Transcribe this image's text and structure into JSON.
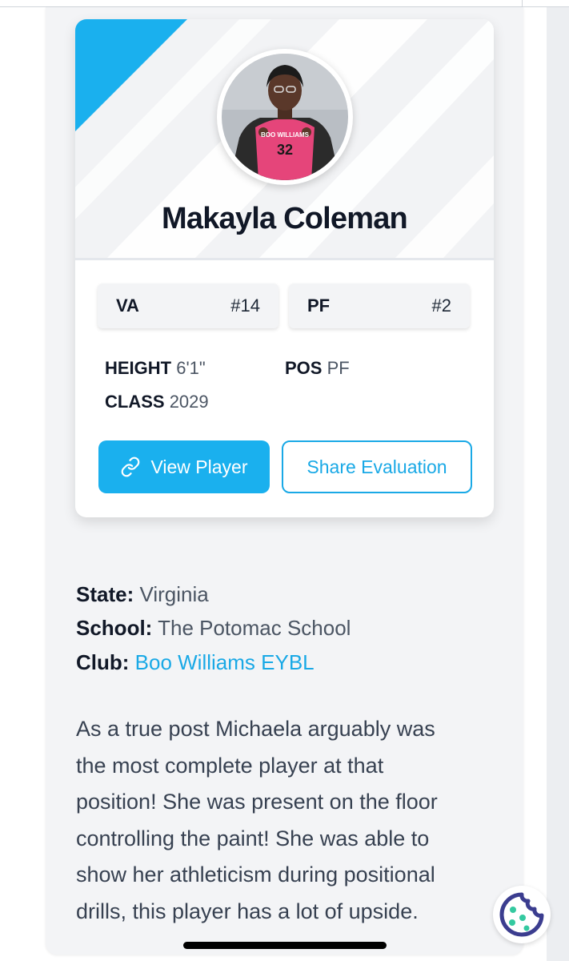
{
  "player": {
    "name": "Makayla Coleman",
    "jersey_text": "BOO WILLIAMS",
    "jersey_number": "32"
  },
  "rankings": [
    {
      "code": "VA",
      "rank": "#14"
    },
    {
      "code": "PF",
      "rank": "#2"
    }
  ],
  "attributes": {
    "height_label": "HEIGHT",
    "height_value": "6'1\"",
    "class_label": "CLASS",
    "class_value": "2029",
    "pos_label": "POS",
    "pos_value": "PF"
  },
  "actions": {
    "view_player": "View Player",
    "share_evaluation": "Share Evaluation"
  },
  "details": {
    "state_label": "State:",
    "state_value": "Virginia",
    "school_label": "School:",
    "school_value": "The Potomac School",
    "club_label": "Club:",
    "club_value": "Boo Williams EYBL"
  },
  "bio_lines": [
    "As a true post Michaela arguably was",
    "the most complete player at that",
    "position! She was present on the floor",
    "controlling the paint! She was able to",
    "show her athleticism during positional",
    "drills, this player has a lot of upside."
  ],
  "colors": {
    "accent": "#1ab0ee",
    "link": "#1aa9e6",
    "cookie": "#3b3d8f",
    "jersey": "#e5457a"
  },
  "icons": {
    "link": "link-icon",
    "cookie": "cookie-icon"
  }
}
